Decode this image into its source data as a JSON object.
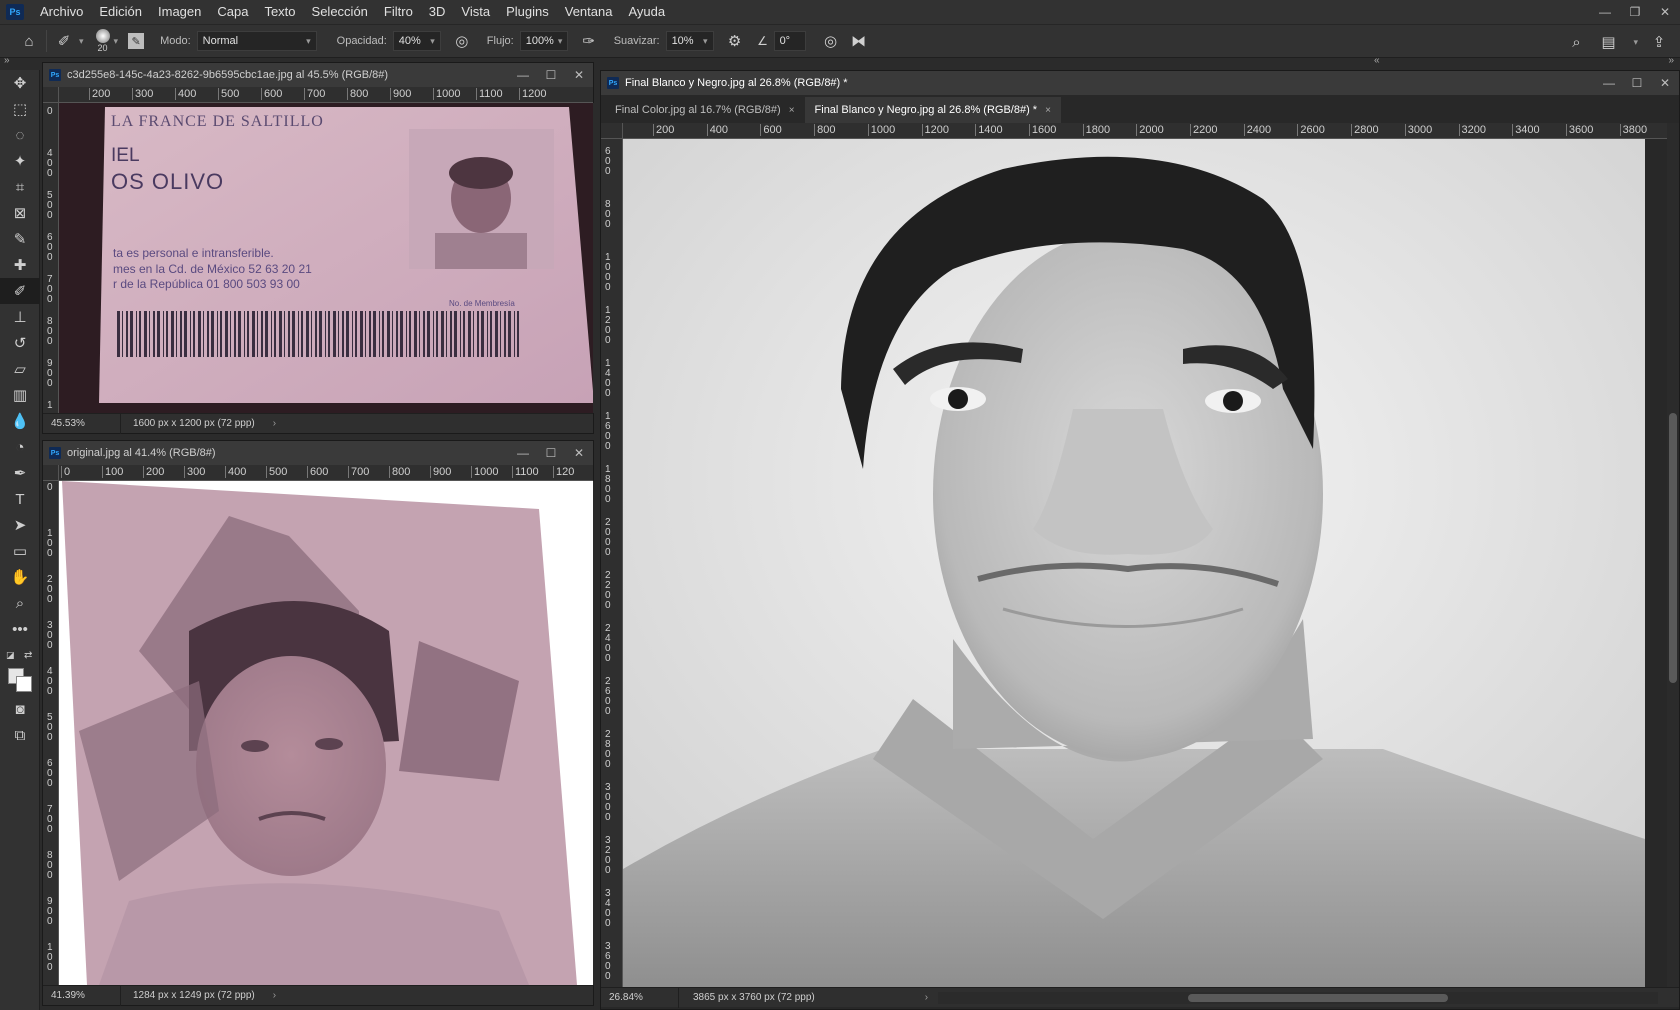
{
  "menubar": {
    "logo": "Ps",
    "items": [
      "Archivo",
      "Edición",
      "Imagen",
      "Capa",
      "Texto",
      "Selección",
      "Filtro",
      "3D",
      "Vista",
      "Plugins",
      "Ventana",
      "Ayuda"
    ]
  },
  "options": {
    "brush_size": "20",
    "mode_label": "Modo:",
    "mode_value": "Normal",
    "opacity_label": "Opacidad:",
    "opacity_value": "40%",
    "flow_label": "Flujo:",
    "flow_value": "100%",
    "smoothing_label": "Suavizar:",
    "smoothing_value": "10%",
    "angle_value": "0°"
  },
  "toolbar": {
    "tools": [
      {
        "name": "move-tool",
        "icon": "✥"
      },
      {
        "name": "marquee-tool",
        "icon": "⬚"
      },
      {
        "name": "lasso-tool",
        "icon": "◌"
      },
      {
        "name": "magic-wand-tool",
        "icon": "✦"
      },
      {
        "name": "crop-tool",
        "icon": "⌗"
      },
      {
        "name": "frame-tool",
        "icon": "⊠"
      },
      {
        "name": "eyedropper-tool",
        "icon": "✎"
      },
      {
        "name": "healing-brush-tool",
        "icon": "✚"
      },
      {
        "name": "brush-tool",
        "icon": "✐"
      },
      {
        "name": "clone-stamp-tool",
        "icon": "⊥"
      },
      {
        "name": "history-brush-tool",
        "icon": "↺"
      },
      {
        "name": "eraser-tool",
        "icon": "▱"
      },
      {
        "name": "gradient-tool",
        "icon": "▥"
      },
      {
        "name": "blur-tool",
        "icon": "💧"
      },
      {
        "name": "dodge-tool",
        "icon": "◔"
      },
      {
        "name": "pen-tool",
        "icon": "✒"
      },
      {
        "name": "type-tool",
        "icon": "T"
      },
      {
        "name": "path-selection-tool",
        "icon": "➤"
      },
      {
        "name": "rectangle-tool",
        "icon": "▭"
      },
      {
        "name": "hand-tool",
        "icon": "✋"
      },
      {
        "name": "zoom-tool",
        "icon": "⌕"
      },
      {
        "name": "more-tools",
        "icon": "•••"
      }
    ]
  },
  "doc1": {
    "title": "c3d255e8-145c-4a23-8262-9b6595cbc1ae.jpg al 45.5% (RGB/8#)",
    "ruler": [
      "200",
      "300",
      "400",
      "500",
      "600",
      "700",
      "800",
      "900",
      "1000",
      "1100",
      "1200"
    ],
    "ruler_v": [
      "0",
      "4\n0\n0",
      "5\n0\n0",
      "6\n0\n0",
      "7\n0\n0",
      "8\n0\n0",
      "9\n0\n0",
      "1"
    ],
    "zoom": "45.53%",
    "dims": "1600 px x 1200 px (72 ppp)",
    "card_lines": [
      "LA FRANCE DE SALTILLO",
      "IEL",
      "OS OLIVO",
      "ta es personal e intransferible.",
      "mes en la Cd. de México 52 63 20 21",
      "r de la República 01 800 503 93 00",
      "No. de Membresía"
    ]
  },
  "doc2": {
    "title": "original.jpg al 41.4% (RGB/8#)",
    "ruler": [
      "0",
      "100",
      "200",
      "300",
      "400",
      "500",
      "600",
      "700",
      "800",
      "900",
      "1000",
      "1100",
      "120"
    ],
    "ruler_v": [
      "0",
      "1\n0\n0",
      "2\n0\n0",
      "3\n0\n0",
      "4\n0\n0",
      "5\n0\n0",
      "6\n0\n0",
      "7\n0\n0",
      "8\n0\n0",
      "9\n0\n0",
      "1\n0\n0"
    ],
    "zoom": "41.39%",
    "dims": "1284 px x 1249 px (72 ppp)"
  },
  "doc3": {
    "title": "Final Blanco y Negro.jpg al 26.8% (RGB/8#) *",
    "tabs": [
      {
        "label": "Final Color.jpg al 16.7% (RGB/8#)",
        "close": "×"
      },
      {
        "label": "Final Blanco y Negro.jpg al 26.8% (RGB/8#) *",
        "close": "×"
      }
    ],
    "ruler": [
      "200",
      "400",
      "600",
      "800",
      "1000",
      "1200",
      "1400",
      "1600",
      "1800",
      "2000",
      "2200",
      "2400",
      "2600",
      "2800",
      "3000",
      "3200",
      "3400",
      "3600",
      "3800"
    ],
    "ruler_v": [
      "6\n0\n0",
      "8\n0\n0",
      "1\n0\n0\n0",
      "1\n2\n0\n0",
      "1\n4\n0\n0",
      "1\n6\n0\n0",
      "1\n8\n0\n0",
      "2\n0\n0\n0",
      "2\n2\n0\n0",
      "2\n4\n0\n0",
      "2\n6\n0\n0",
      "2\n8\n0\n0",
      "3\n0\n0\n0",
      "3\n2\n0\n0",
      "3\n4\n0\n0",
      "3\n6\n0\n0"
    ],
    "zoom": "26.84%",
    "dims": "3865 px x 3760 px (72 ppp)"
  }
}
